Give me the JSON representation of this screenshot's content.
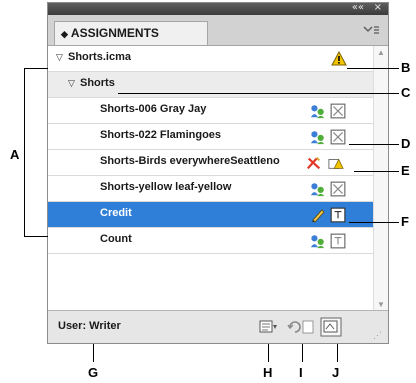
{
  "panel": {
    "title": "ASSIGNMENTS",
    "titlebar_controls": [
      "««",
      "×"
    ],
    "menu_icon": "panel-menu-icon"
  },
  "rows": [
    {
      "label": "Shorts.icma",
      "type": "document",
      "icons": [
        "warning-icon"
      ]
    },
    {
      "label": "Shorts",
      "type": "assignment-group",
      "icons": []
    },
    {
      "label": "Shorts-006 Gray Jay",
      "type": "story",
      "icons": [
        "checked-out-icon",
        "text-frame-icon"
      ]
    },
    {
      "label": "Shorts-022 Flamingoes",
      "type": "story",
      "icons": [
        "checked-out-icon",
        "text-frame-icon"
      ]
    },
    {
      "label": "Shorts-Birds everywhereSeattleno",
      "type": "story",
      "icons": [
        "missing-icon",
        "warning-frame-icon"
      ]
    },
    {
      "label": "Shorts-yellow leaf-yellow",
      "type": "story",
      "icons": [
        "checked-out-icon",
        "text-frame-icon"
      ]
    },
    {
      "label": "Credit",
      "type": "story",
      "selected": true,
      "icons": [
        "pencil-icon",
        "text-frame-icon"
      ]
    },
    {
      "label": "Count",
      "type": "story",
      "icons": [
        "checked-out-icon",
        "text-frame-icon"
      ]
    }
  ],
  "footer": {
    "user": "User: Writer",
    "buttons": [
      "update-content-icon",
      "check-out-icon",
      "check-in-icon"
    ]
  },
  "callouts": {
    "A": "A",
    "B": "B",
    "C": "C",
    "D": "D",
    "E": "E",
    "F": "F",
    "G": "G",
    "H": "H",
    "I": "I",
    "J": "J"
  }
}
